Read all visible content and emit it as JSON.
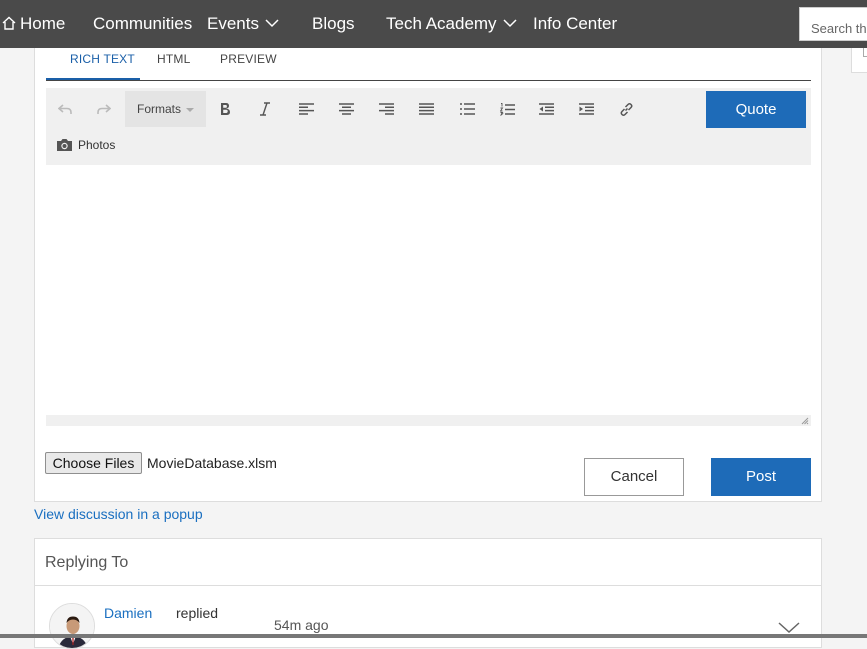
{
  "nav": {
    "items": [
      {
        "label": "Home"
      },
      {
        "label": "Communities"
      },
      {
        "label": "Events"
      },
      {
        "label": "Blogs"
      },
      {
        "label": "Tech Academy"
      },
      {
        "label": "Info Center"
      }
    ],
    "search_placeholder": "Search the"
  },
  "editor": {
    "tabs": [
      {
        "label": "RICH TEXT",
        "active": true
      },
      {
        "label": "HTML",
        "active": false
      },
      {
        "label": "PREVIEW",
        "active": false
      }
    ],
    "toolbar": {
      "formats_label": "Formats",
      "quote_label": "Quote",
      "photos_label": "Photos",
      "icons": [
        "undo-icon",
        "redo-icon",
        "bold-icon",
        "italic-icon",
        "align-left-icon",
        "align-center-icon",
        "align-right-icon",
        "justify-icon",
        "bullet-list-icon",
        "numbered-list-icon",
        "outdent-icon",
        "indent-icon",
        "link-icon",
        "camera-icon"
      ]
    },
    "attachment": {
      "choose_label": "Choose Files",
      "file_name": "MovieDatabase.xlsm"
    },
    "cancel_label": "Cancel",
    "post_label": "Post"
  },
  "popup_link": "View discussion in a popup",
  "replying": {
    "title": "Replying To",
    "author": "Damien",
    "action": "replied",
    "time": "54m ago"
  },
  "colors": {
    "nav_bg": "#4a4a4a",
    "accent": "#1e6bb8",
    "link": "#1a6fc0"
  }
}
